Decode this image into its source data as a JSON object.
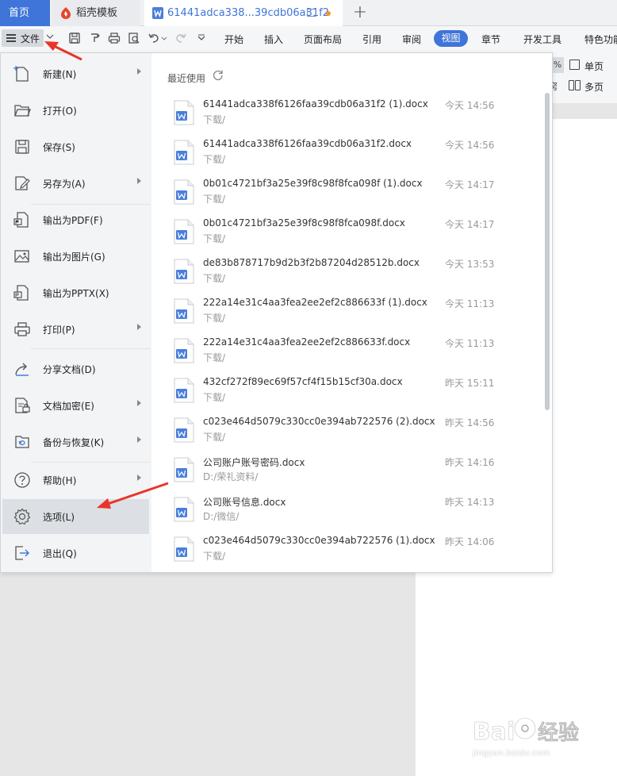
{
  "tabs": {
    "home": "首页",
    "template": "稻壳模板",
    "document": "61441adca338...39cdb06a31f2"
  },
  "toolbar": {
    "file_label": "文件",
    "tabs": [
      "开始",
      "插入",
      "页面布局",
      "引用",
      "审阅",
      "视图",
      "章节",
      "开发工具",
      "特色功能"
    ],
    "active_tab": "视图",
    "right_items": {
      "percent": "%",
      "single_page": "单页",
      "multi_page": "多页",
      "partial_char": "窍"
    }
  },
  "menu": {
    "items": [
      {
        "label": "新建(N)",
        "icon": "new-doc-icon",
        "has_submenu": true
      },
      {
        "label": "打开(O)",
        "icon": "open-folder-icon",
        "has_submenu": false
      },
      {
        "label": "保存(S)",
        "icon": "save-icon",
        "has_submenu": false
      },
      {
        "label": "另存为(A)",
        "icon": "save-as-icon",
        "has_submenu": true
      },
      {
        "label": "输出为PDF(F)",
        "icon": "export-pdf-icon",
        "has_submenu": false
      },
      {
        "label": "输出为图片(G)",
        "icon": "export-image-icon",
        "has_submenu": false
      },
      {
        "label": "输出为PPTX(X)",
        "icon": "export-pptx-icon",
        "has_submenu": false
      },
      {
        "label": "打印(P)",
        "icon": "print-icon",
        "has_submenu": true
      },
      {
        "label": "分享文档(D)",
        "icon": "share-icon",
        "has_submenu": false
      },
      {
        "label": "文档加密(E)",
        "icon": "encrypt-icon",
        "has_submenu": true
      },
      {
        "label": "备份与恢复(K)",
        "icon": "backup-icon",
        "has_submenu": true
      },
      {
        "label": "帮助(H)",
        "icon": "help-icon",
        "has_submenu": true
      },
      {
        "label": "选项(L)",
        "icon": "gear-icon",
        "has_submenu": false,
        "selected": true
      },
      {
        "label": "退出(Q)",
        "icon": "exit-icon",
        "has_submenu": false
      }
    ]
  },
  "recent": {
    "title": "最近使用",
    "files": [
      {
        "name": "61441adca338f6126faa39cdb06a31f2 (1).docx",
        "path": "下载/",
        "time": "今天 14:56"
      },
      {
        "name": "61441adca338f6126faa39cdb06a31f2.docx",
        "path": "下载/",
        "time": "今天 14:56"
      },
      {
        "name": "0b01c4721bf3a25e39f8c98f8fca098f (1).docx",
        "path": "下载/",
        "time": "今天 14:17"
      },
      {
        "name": "0b01c4721bf3a25e39f8c98f8fca098f.docx",
        "path": "下载/",
        "time": "今天 14:17"
      },
      {
        "name": "de83b878717b9d2b3f2b87204d28512b.docx",
        "path": "下载/",
        "time": "今天 13:53"
      },
      {
        "name": "222a14e31c4aa3fea2ee2ef2c886633f (1).docx",
        "path": "下载/",
        "time": "今天 11:13"
      },
      {
        "name": "222a14e31c4aa3fea2ee2ef2c886633f.docx",
        "path": "下载/",
        "time": "今天 11:13"
      },
      {
        "name": "432cf272f89ec69f57cf4f15b15cf30a.docx",
        "path": "下载/",
        "time": "昨天 15:11"
      },
      {
        "name": "c023e464d5079c330cc0e394ab722576 (2).docx",
        "path": "下载/",
        "time": "昨天 14:56"
      },
      {
        "name": "公司账户账号密码.docx",
        "path": "D:/荣礼资料/",
        "time": "昨天 14:16"
      },
      {
        "name": "公司账号信息.docx",
        "path": "D:/微信/",
        "time": "昨天 14:13"
      },
      {
        "name": "c023e464d5079c330cc0e394ab722576 (1).docx",
        "path": "下载/",
        "time": "昨天 14:06"
      }
    ]
  },
  "colors": {
    "accent": "#3f74d8",
    "annotation_arrow": "#e8352a",
    "doc_icon": "#4a7fdb"
  },
  "watermark": {
    "text": "jingyan.baidu.com",
    "brand": "Bai经验"
  }
}
